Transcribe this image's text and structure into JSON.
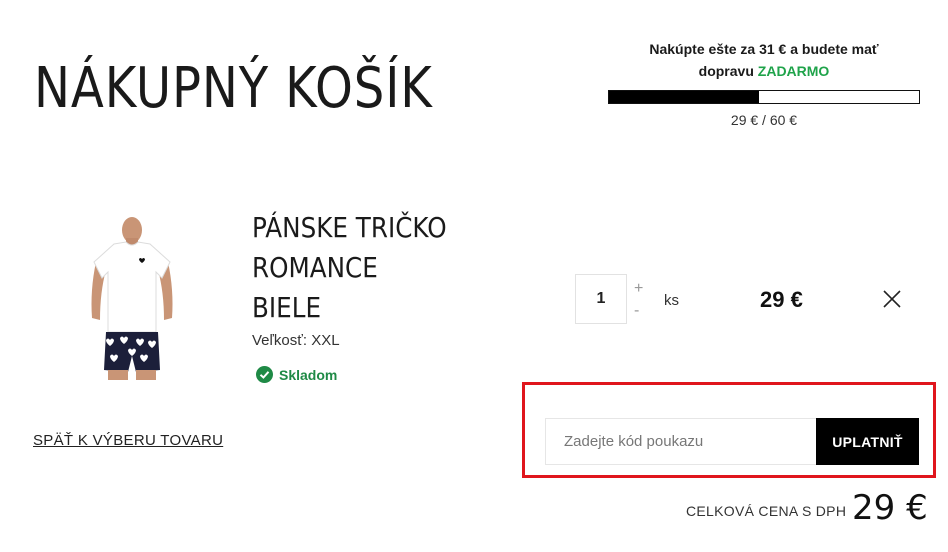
{
  "page_title": "NÁKUPNÝ KOŠÍK",
  "shipping": {
    "message_line1": "Nakúpte ešte za 31 € a budete mať",
    "message_prefix": "dopravu",
    "message_free": "ZADARMO",
    "progress_label": "29 € / 60 €",
    "progress_fraction": 0.483,
    "free_color": "#1fa34a"
  },
  "cart_item": {
    "name_line1": "PÁNSKE TRIČKO",
    "name_line2": "ROMANCE",
    "name_line3": "BIELE",
    "size": "Veľkosť: XXL",
    "stock": "Skladom",
    "quantity": "1",
    "plus": "+",
    "minus": "-",
    "unit": "ks",
    "price": "29 €",
    "image_icon": "tshirt-product-photo",
    "stock_icon": "check-circle-icon",
    "remove_icon": "close-icon"
  },
  "back_link": "SPÄŤ K VÝBERU TOVARU",
  "voucher": {
    "placeholder": "Zadejte kód poukazu",
    "button": "UPLATNIŤ",
    "highlight_color": "#e0161d"
  },
  "total": {
    "label": "CELKOVÁ CENA S DPH",
    "value": "29 €"
  }
}
